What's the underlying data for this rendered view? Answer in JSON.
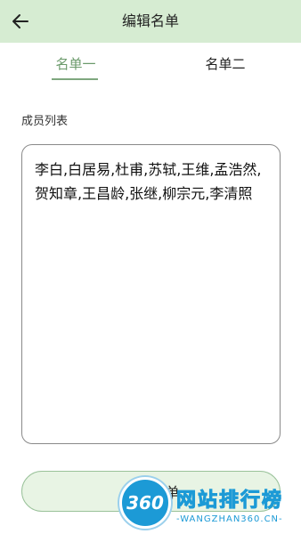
{
  "header": {
    "title": "编辑名单",
    "back_icon": "arrow-left-icon"
  },
  "tabs": [
    {
      "label": "名单一",
      "active": true
    },
    {
      "label": "名单二",
      "active": false
    }
  ],
  "section": {
    "label": "成员列表"
  },
  "members": {
    "value": "李白,白居易,杜甫,苏轼,王维,孟浩然,贺知章,王昌龄,张继,柳宗元,李清照"
  },
  "actions": {
    "use_button_label": "使用名单"
  },
  "watermark": {
    "badge": "360",
    "name": "网站排行榜",
    "url": "WANGZHAN360.CN"
  },
  "colors": {
    "appbar_bg": "#d6ecd2",
    "accent": "#6b9a6b",
    "button_bg": "#e8f4e4",
    "watermark_blue": "#1c9ad6"
  }
}
